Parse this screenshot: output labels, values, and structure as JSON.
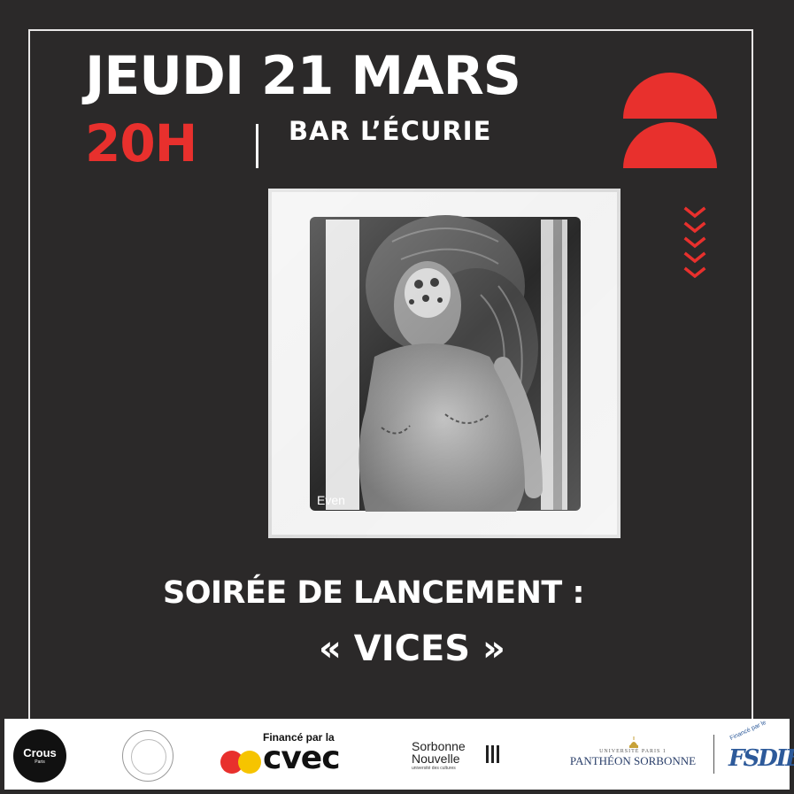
{
  "poster": {
    "date": "JEUDI 21 MARS",
    "time": "20H",
    "venue": "BAR L’ÉCURIE",
    "photo_caption": "Even",
    "title": "SOIRÉE DE LANCEMENT :",
    "subtitle": "« VICES »"
  },
  "colors": {
    "background": "#2b2929",
    "accent_red": "#e8302d",
    "text": "#ffffff",
    "cvec_yellow": "#f6c400",
    "pantheon_blue": "#2a3f6a",
    "fsdie_blue": "#2d5a9a"
  },
  "logos": {
    "crous": {
      "name": "Crous",
      "sub": "Paris"
    },
    "cvec": {
      "funded_by": "Financé par la",
      "name": "cvec"
    },
    "sorbonne_nouvelle": {
      "line1": "Sorbonne",
      "line2": "Nouvelle",
      "tagline": "université des cultures"
    },
    "pantheon": {
      "top": "UNIVERSITÉ PARIS 1",
      "name": "PANTHÉON SORBONNE"
    },
    "fsdie": {
      "funded_by": "Financé par le",
      "name": "FSDIE"
    }
  }
}
